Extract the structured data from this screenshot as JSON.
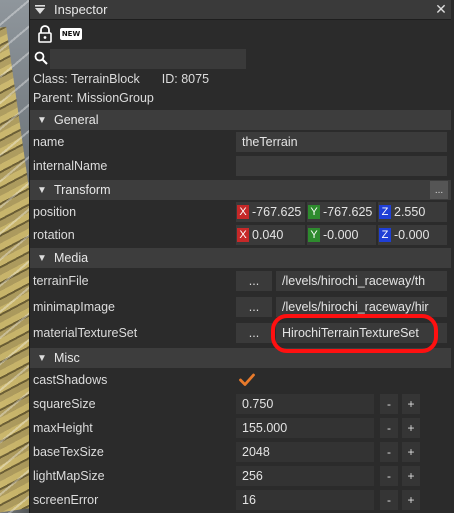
{
  "window": {
    "title": "Inspector",
    "close_glyph": "✕"
  },
  "toolbar": {
    "lock_icon": "lock-icon",
    "new_label": "NEW"
  },
  "search": {
    "value": ""
  },
  "info": {
    "class_text": "Class: TerrainBlock",
    "id_text": "ID: 8075",
    "parent_text": "Parent: MissionGroup"
  },
  "sections": {
    "general": "General",
    "transform": "Transform",
    "media": "Media",
    "misc": "Misc",
    "more_label": "..."
  },
  "fields": {
    "name": {
      "label": "name",
      "value": "theTerrain"
    },
    "internalName": {
      "label": "internalName",
      "value": ""
    },
    "position": {
      "label": "position",
      "x": "-767.625",
      "y": "-767.625",
      "z": "2.550"
    },
    "rotation": {
      "label": "rotation",
      "x": "0.040",
      "y": "-0.000",
      "z": "-0.000"
    },
    "terrainFile": {
      "label": "terrainFile",
      "value": "/levels/hirochi_raceway/th"
    },
    "minimapImage": {
      "label": "minimapImage",
      "value": "/levels/hirochi_raceway/hir"
    },
    "materialTextureSet": {
      "label": "materialTextureSet",
      "value": "HirochiTerrainTextureSet"
    },
    "castShadows": {
      "label": "castShadows",
      "checked": true
    },
    "squareSize": {
      "label": "squareSize",
      "value": "0.750"
    },
    "maxHeight": {
      "label": "maxHeight",
      "value": "155.000"
    },
    "baseTexSize": {
      "label": "baseTexSize",
      "value": "2048"
    },
    "lightMapSize": {
      "label": "lightMapSize",
      "value": "256"
    },
    "screenError": {
      "label": "screenError",
      "value": "16"
    }
  },
  "axis_labels": {
    "x": "X",
    "y": "Y",
    "z": "Z"
  },
  "controls": {
    "browse": "...",
    "minus": "-",
    "plus": "+"
  },
  "colors": {
    "axis_x": "#c62828",
    "axis_y": "#2e8b2e",
    "axis_z": "#1f3fd6",
    "check": "#e87a2b",
    "highlight": "#ff1010"
  }
}
